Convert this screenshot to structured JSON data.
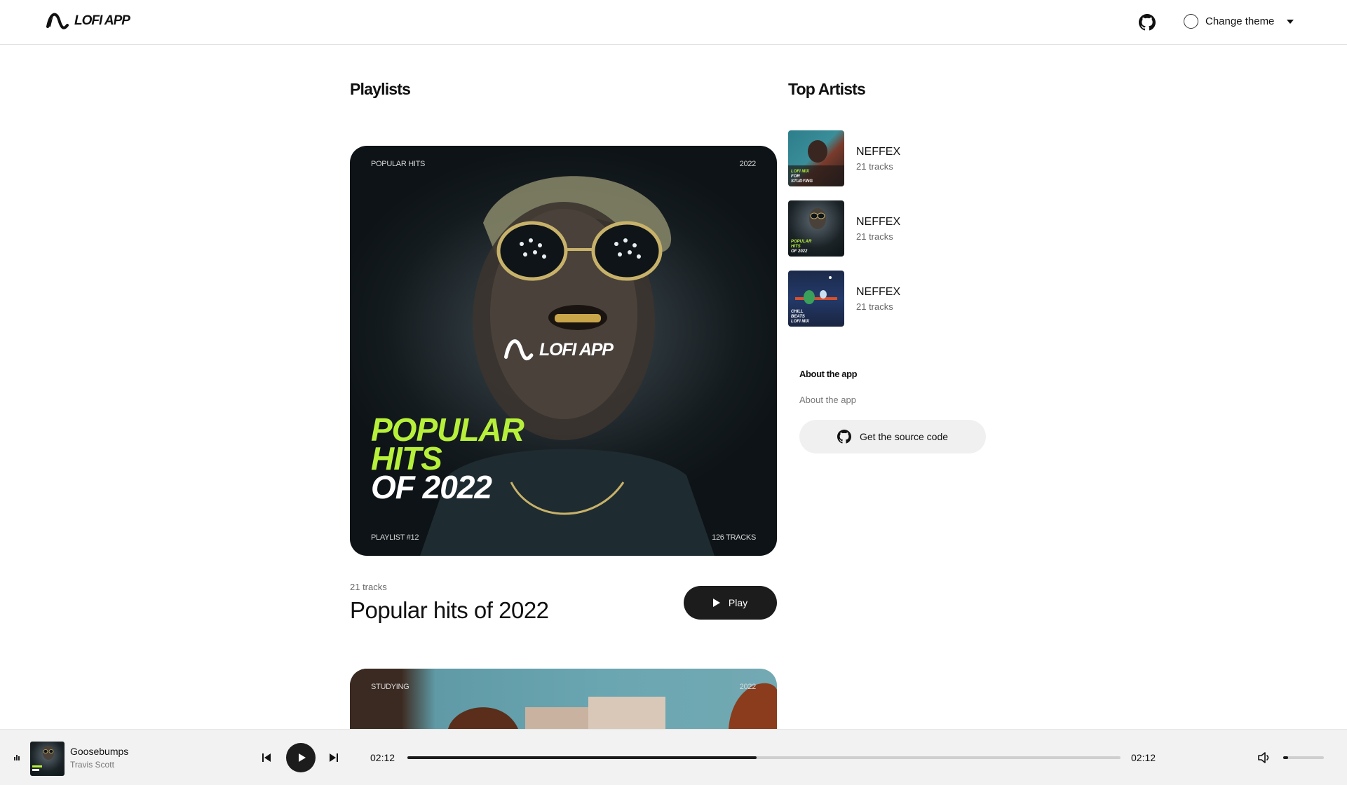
{
  "header": {
    "logo_text": "LOFI APP",
    "theme_label": "Change theme"
  },
  "playlists": {
    "title": "Playlists",
    "featured": {
      "cover_top_left": "POPULAR HITS",
      "cover_top_right": "2022",
      "cover_logo": "LOFI APP",
      "cover_title_line1": "POPULAR",
      "cover_title_line2": "HITS",
      "cover_title_line3": "OF 2022",
      "cover_bottom_left": "PLAYLIST #12",
      "cover_bottom_right": "126 TRACKS",
      "tracks": "21 tracks",
      "name": "Popular hits of 2022",
      "play_label": "Play"
    },
    "second": {
      "cover_top_left": "STUDYING",
      "cover_top_right": "2022"
    }
  },
  "top_artists": {
    "title": "Top Artists",
    "items": [
      {
        "name": "NEFFEX",
        "tracks": "21 tracks",
        "thumb_text": "LOFI MIX FOR STUDYING"
      },
      {
        "name": "NEFFEX",
        "tracks": "21 tracks",
        "thumb_text": "POPULAR HITS OF 2022"
      },
      {
        "name": "NEFFEX",
        "tracks": "21 tracks",
        "thumb_text": "CHILL BEATS LOFI MIX"
      }
    ]
  },
  "about": {
    "title": "About the app",
    "text": "About the app",
    "source_button": "Get the source code"
  },
  "player": {
    "song": "Goosebumps",
    "artist": "Travis Scott",
    "current_time": "02:12",
    "total_time": "02:12",
    "progress_fraction": 0.49,
    "volume_fraction": 0.12
  },
  "colors": {
    "accent_green": "#b7f03a",
    "dark": "#1c1c1c"
  }
}
